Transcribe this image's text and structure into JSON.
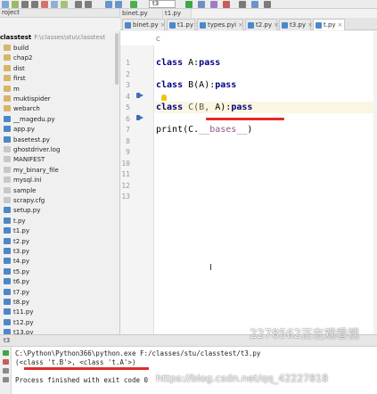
{
  "toolbar": {
    "run_config": "t3"
  },
  "project_header": {
    "label": "roject"
  },
  "mini_tabs": [
    "binet.py",
    "t1.py"
  ],
  "tabs": [
    {
      "label": "binet.py"
    },
    {
      "label": "t1.py"
    },
    {
      "label": "types.pyi"
    },
    {
      "label": "t2.py"
    },
    {
      "label": "t3.py"
    },
    {
      "label": "t.py"
    }
  ],
  "tree": {
    "root_name": "classtest",
    "root_path": "F:\\classes\\stu\\classtest",
    "items": [
      {
        "label": "build",
        "kind": "folder"
      },
      {
        "label": "chap2",
        "kind": "folder"
      },
      {
        "label": "dist",
        "kind": "folder"
      },
      {
        "label": "first",
        "kind": "folder"
      },
      {
        "label": "m",
        "kind": "folder"
      },
      {
        "label": "muktispider",
        "kind": "folder"
      },
      {
        "label": "webarch",
        "kind": "folder"
      },
      {
        "label": "__magedu.py",
        "kind": "py"
      },
      {
        "label": "app.py",
        "kind": "py"
      },
      {
        "label": "basetest.py",
        "kind": "py"
      },
      {
        "label": "ghostdriver.log",
        "kind": "txt"
      },
      {
        "label": "MANIFEST",
        "kind": "txt"
      },
      {
        "label": "my_binary_file",
        "kind": "txt"
      },
      {
        "label": "mysql.ini",
        "kind": "txt"
      },
      {
        "label": "sample",
        "kind": "txt"
      },
      {
        "label": "scrapy.cfg",
        "kind": "txt"
      },
      {
        "label": "setup.py",
        "kind": "py"
      },
      {
        "label": "t.py",
        "kind": "py"
      },
      {
        "label": "t1.py",
        "kind": "py"
      },
      {
        "label": "t2.py",
        "kind": "py"
      },
      {
        "label": "t3.py",
        "kind": "py"
      },
      {
        "label": "t4.py",
        "kind": "py"
      },
      {
        "label": "t5.py",
        "kind": "py"
      },
      {
        "label": "t6.py",
        "kind": "py"
      },
      {
        "label": "t7.py",
        "kind": "py"
      },
      {
        "label": "t8.py",
        "kind": "py"
      },
      {
        "label": "t11.py",
        "kind": "py"
      },
      {
        "label": "t12.py",
        "kind": "py"
      },
      {
        "label": "t13.py",
        "kind": "py"
      }
    ]
  },
  "editor": {
    "breadcrumb": "C",
    "line_numbers": [
      "1",
      "2",
      "3",
      "4",
      "5",
      "6",
      "7",
      "8",
      "9",
      "10",
      "11",
      "12",
      "13"
    ],
    "lines": {
      "l2_kw": "class",
      "l2_rest": " A:",
      "l2_pass": "pass",
      "l4_kw": "class",
      "l4_rest": " B(A):",
      "l4_pass": "pass",
      "l6_kw": "class",
      "l6_a": " C(B, ",
      "l6_b": "A)",
      "l6_c": ":",
      "l6_pass": "pass",
      "l8_a": "print(C.",
      "l8_b": "__bases__",
      "l8_c": ")"
    }
  },
  "run": {
    "tab_label": "t3",
    "output": [
      "C:\\Python\\Python366\\python.exe F:/classes/stu/classtest/t3.py",
      "(<class 't.B'>, <class 't.A'>)",
      "",
      "Process finished with exit code 0"
    ]
  },
  "watermarks": [
    "2278562正在观看视",
    "https://blog.csdn.net/qq_42227818"
  ]
}
